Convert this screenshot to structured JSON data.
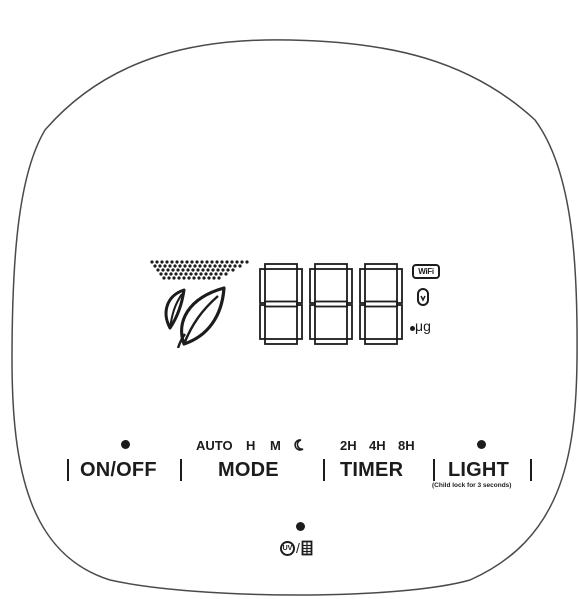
{
  "display": {
    "digits": "888",
    "unit": "μg",
    "wifi_label": "WiFi",
    "icons": [
      "leaf-fan-icon",
      "wifi-icon",
      "filter-icon",
      "sensor-dots-icon"
    ]
  },
  "controls": {
    "onoff_label": "ON/OFF",
    "mode_label": "MODE",
    "timer_label": "TIMER",
    "light_label": "LIGHT",
    "light_sublabel": "(Child lock for 3 seconds)",
    "mode_indicators": {
      "auto": "AUTO",
      "h": "H",
      "m": "M",
      "sleep_icon": "moon-icon"
    },
    "timer_indicators": [
      "2H",
      "4H",
      "8H"
    ],
    "uv_icon_label": "UV",
    "uv_separator": "/"
  },
  "colors": {
    "ink": "#1c1c1c",
    "panel_outline": "#4a4a4a",
    "background": "#ffffff"
  }
}
